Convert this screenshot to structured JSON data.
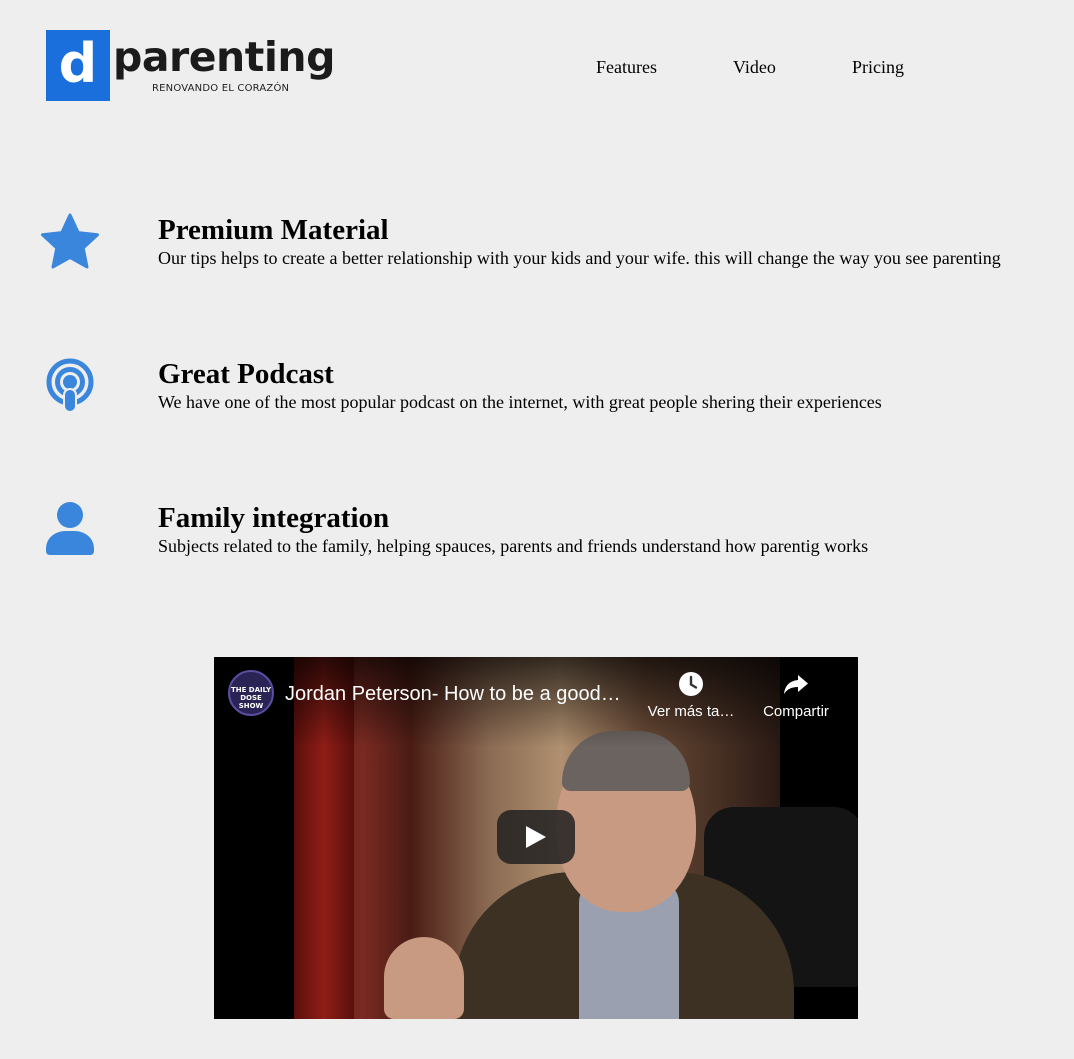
{
  "header": {
    "logo_letter": "d",
    "logo_word": "parenting",
    "logo_tagline": "RENOVANDO EL CORAZÓN",
    "nav": [
      "Features",
      "Video",
      "Pricing"
    ]
  },
  "features": [
    {
      "icon": "star-icon",
      "title": "Premium Material",
      "text": "Our tips helps to create a better relationship with your kids and your wife. this will change the way you see parenting"
    },
    {
      "icon": "podcast-icon",
      "title": "Great Podcast",
      "text": "We have one of the most popular podcast on the internet, with great people shering their experiences"
    },
    {
      "icon": "user-icon",
      "title": "Family integration",
      "text": "Subjects related to the family, helping spauces, parents and friends understand how parentig works"
    }
  ],
  "video": {
    "channel_avatar_text": "THE DAILY DOSE SHOW",
    "title": "Jordan Peterson- How to be a good…",
    "watch_later_label": "Ver más ta…",
    "share_label": "Compartir"
  },
  "colors": {
    "accent": "#3a86dc",
    "logo_blue": "#1a6fdc",
    "background": "#eeeeee"
  }
}
